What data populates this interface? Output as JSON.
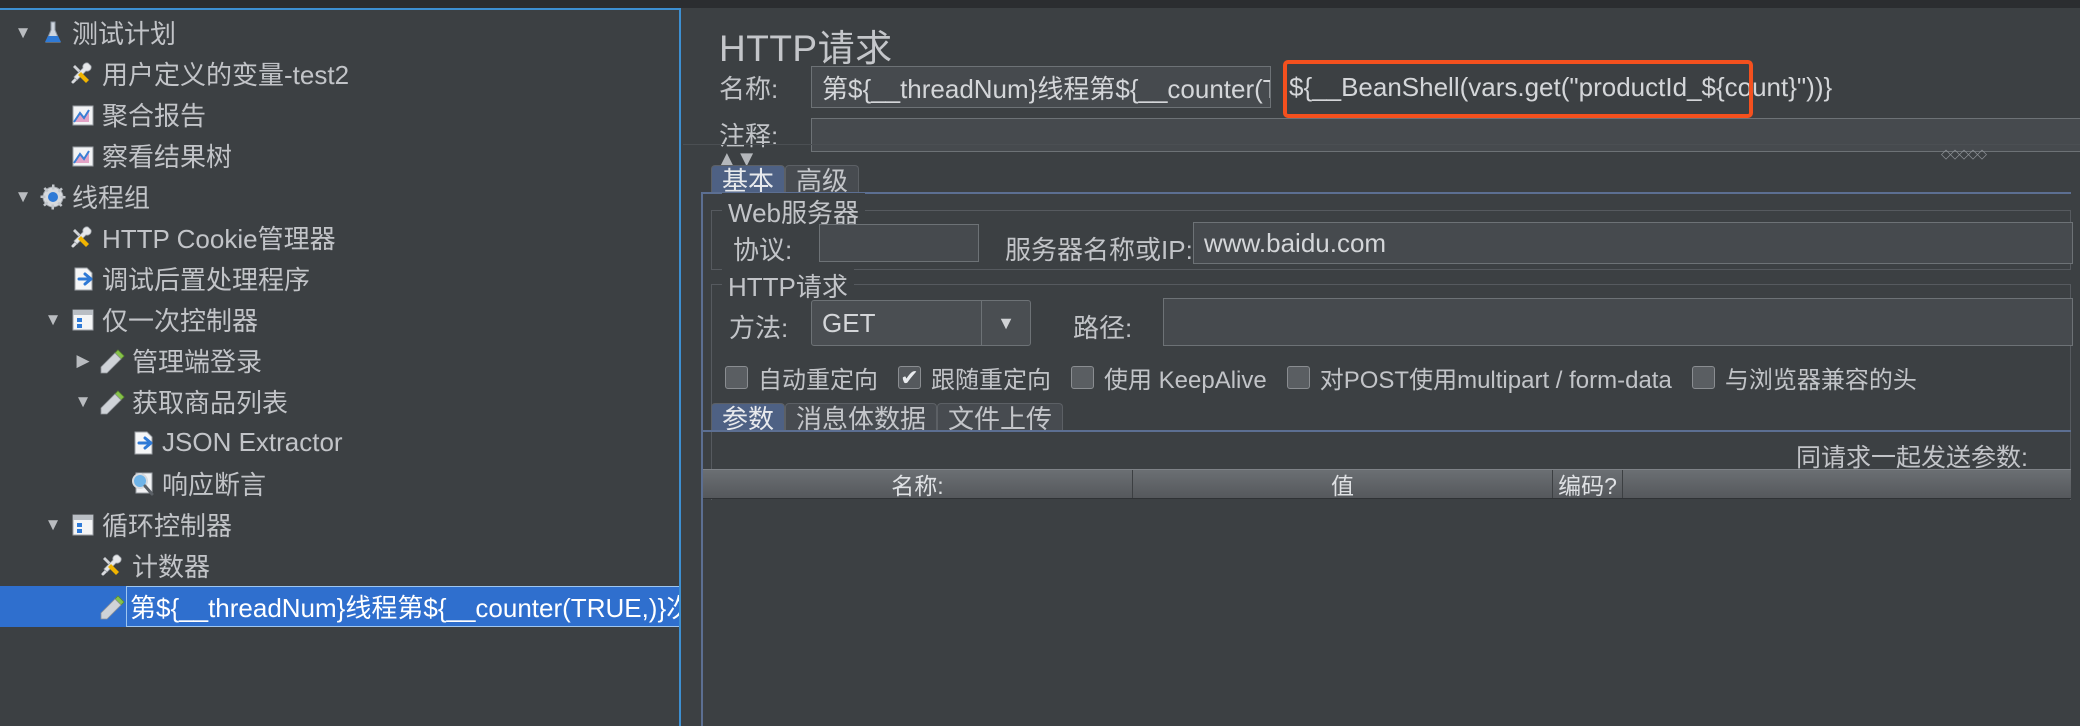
{
  "tree": {
    "items": [
      {
        "twisty": "▼",
        "icon": "flask-icon",
        "label": "测试计划",
        "indent": 0,
        "selected": false
      },
      {
        "twisty": "",
        "icon": "tools-icon",
        "label": "用户定义的变量-test2",
        "indent": 1,
        "selected": false
      },
      {
        "twisty": "",
        "icon": "chart-icon",
        "label": "聚合报告",
        "indent": 1,
        "selected": false
      },
      {
        "twisty": "",
        "icon": "chart-icon",
        "label": "察看结果树",
        "indent": 1,
        "selected": false
      },
      {
        "twisty": "▼",
        "icon": "gear-icon",
        "label": "线程组",
        "indent": 0,
        "selected": false
      },
      {
        "twisty": "",
        "icon": "tools-icon",
        "label": "HTTP Cookie管理器",
        "indent": 1,
        "selected": false
      },
      {
        "twisty": "",
        "icon": "postprocessor-icon",
        "label": "调试后置处理程序",
        "indent": 1,
        "selected": false
      },
      {
        "twisty": "▼",
        "icon": "controller-icon",
        "label": "仅一次控制器",
        "indent": 1,
        "selected": false
      },
      {
        "twisty": "▶",
        "icon": "sampler-icon",
        "label": "管理端登录",
        "indent": 2,
        "selected": false
      },
      {
        "twisty": "▼",
        "icon": "sampler-icon",
        "label": "获取商品列表",
        "indent": 2,
        "selected": false
      },
      {
        "twisty": "",
        "icon": "postprocessor-icon",
        "label": "JSON Extractor",
        "indent": 3,
        "selected": false
      },
      {
        "twisty": "",
        "icon": "assertion-icon",
        "label": "响应断言",
        "indent": 3,
        "selected": false
      },
      {
        "twisty": "▼",
        "icon": "controller-icon",
        "label": "循环控制器",
        "indent": 1,
        "selected": false
      },
      {
        "twisty": "",
        "icon": "tools-icon",
        "label": "计数器",
        "indent": 2,
        "selected": false
      },
      {
        "twisty": "",
        "icon": "sampler-icon",
        "label": "第${__threadNum}线程第${__counter(TRUE,)}次,",
        "indent": 2,
        "selected": true
      }
    ]
  },
  "panel": {
    "title": "HTTP请求",
    "name_label": "名称:",
    "name_value": "第${__threadNum}线程第${__counter(TRUE,)}次,",
    "name_value_2": "${__BeanShell(vars.get(\"productId_${count}\"))}",
    "comment_label": "注释:",
    "comment_value": "",
    "sort_arrows": "▲▼",
    "split_grip": "◇◇◇◇◇",
    "tabs": [
      {
        "label": "基本",
        "active": true
      },
      {
        "label": "高级",
        "active": false
      }
    ],
    "web_server": {
      "legend": "Web服务器",
      "protocol_label": "协议:",
      "protocol_value": "",
      "server_label": "服务器名称或IP:",
      "server_value": "www.baidu.com"
    },
    "http_request": {
      "legend": "HTTP请求",
      "method_label": "方法:",
      "method_value": "GET",
      "method_arrow": "▼",
      "path_label": "路径:",
      "path_value": "",
      "checkboxes": [
        {
          "label": "自动重定向",
          "checked": false
        },
        {
          "label": "跟随重定向",
          "checked": true
        },
        {
          "label": "使用 KeepAlive",
          "checked": false
        },
        {
          "label": "对POST使用multipart / form-data",
          "checked": false
        },
        {
          "label": "与浏览器兼容的头",
          "checked": false
        }
      ],
      "check_mark": "✔",
      "inner_tabs": [
        {
          "label": "参数",
          "active": true
        },
        {
          "label": "消息体数据",
          "active": false
        },
        {
          "label": "文件上传",
          "active": false
        }
      ],
      "params": {
        "caption": "同请求一起发送参数:",
        "columns": [
          "名称:",
          "值",
          "编码?",
          ""
        ],
        "rows": []
      }
    }
  },
  "colors": {
    "background": "#3c4043",
    "selection": "#2f6fce",
    "accent_border": "#3d8fd1",
    "highlight_box": "#f4501e",
    "tab_active": "#4e6184"
  }
}
